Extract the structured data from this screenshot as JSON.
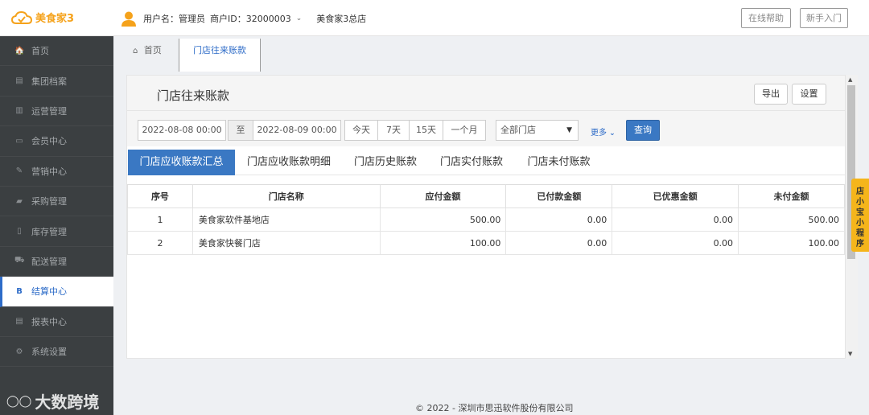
{
  "app": {
    "logo_text": "美食家3",
    "brand_color": "#f5a21b"
  },
  "topbar": {
    "username": "用户名：管理员",
    "merchant_id": "商户ID：32000003",
    "store": "美食家3总店",
    "help_button": "在线帮助",
    "guide_button": "新手入门"
  },
  "sidebar": {
    "items": [
      {
        "icon": "home-icon",
        "glyph": "🏠",
        "label": "首页"
      },
      {
        "icon": "file-icon",
        "glyph": "▤",
        "label": "集团档案"
      },
      {
        "icon": "bar-chart-icon",
        "glyph": "▥",
        "label": "运营管理"
      },
      {
        "icon": "id-card-icon",
        "glyph": "▭",
        "label": "会员中心"
      },
      {
        "icon": "edit-icon",
        "glyph": "✎",
        "label": "营销中心"
      },
      {
        "icon": "book-icon",
        "glyph": "▰",
        "label": "采购管理"
      },
      {
        "icon": "building-icon",
        "glyph": "▯",
        "label": "库存管理"
      },
      {
        "icon": "truck-icon",
        "glyph": "⛟",
        "label": "配送管理"
      },
      {
        "icon": "bitcoin-icon",
        "glyph": "B",
        "label": "结算中心"
      },
      {
        "icon": "report-icon",
        "glyph": "▤",
        "label": "报表中心"
      },
      {
        "icon": "cogs-icon",
        "glyph": "⚙",
        "label": "系统设置"
      }
    ],
    "active_index": 8,
    "watermark": "大数跨境"
  },
  "breadcrumb": {
    "home": "首页",
    "current_tab": "门店往来账款"
  },
  "panel": {
    "title": "门店往来账款",
    "export_button": "导出",
    "settings_button": "设置"
  },
  "filter": {
    "start_date": "2022-08-08 00:00",
    "to_label": "至",
    "end_date": "2022-08-09 00:00",
    "quick": [
      "今天",
      "7天",
      "15天",
      "一个月"
    ],
    "store_select": "全部门店",
    "more": "更多",
    "query_button": "查询"
  },
  "tabs": [
    "门店应收账款汇总",
    "门店应收账款明细",
    "门店历史账款",
    "门店实付账款",
    "门店未付账款"
  ],
  "table": {
    "headers": [
      "序号",
      "门店名称",
      "应付金额",
      "已付款金额",
      "已优惠金额",
      "未付金额"
    ],
    "rows": [
      [
        "1",
        "美食家软件基地店",
        "500.00",
        "0.00",
        "0.00",
        "500.00"
      ],
      [
        "2",
        "美食家快餐门店",
        "100.00",
        "0.00",
        "0.00",
        "100.00"
      ]
    ]
  },
  "mini_program": "店小宝小程序",
  "footer": "© 2022 - 深圳市思迅软件股份有限公司"
}
